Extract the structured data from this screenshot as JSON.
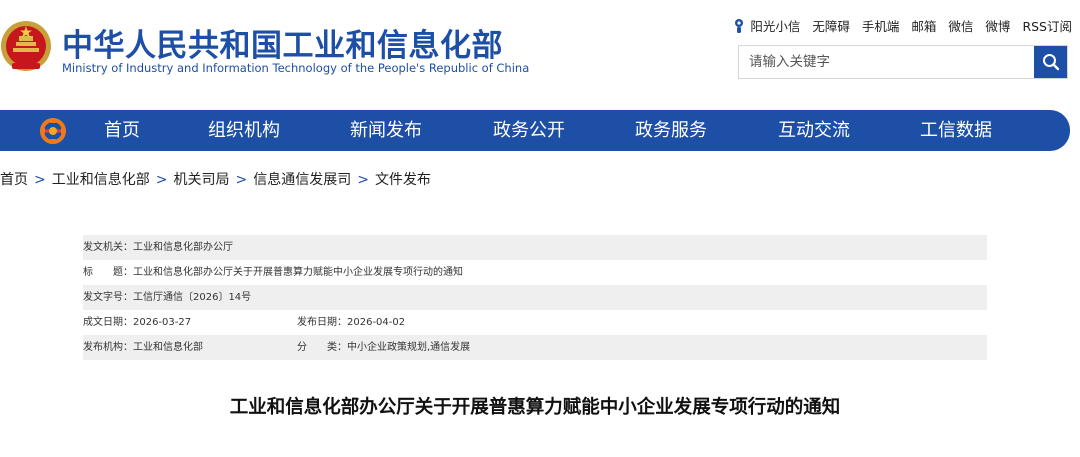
{
  "header": {
    "title_cn": "中华人民共和国工业和信息化部",
    "title_en": "Ministry of Industry and Information Technology of the People's Republic of China",
    "emblem_icon": "national-emblem-icon",
    "top_links": [
      "阳光小信",
      "无障碍",
      "手机端",
      "邮箱",
      "微信",
      "微博",
      "RSS订阅"
    ],
    "search_placeholder": "请输入关键字",
    "search_icon": "search-icon"
  },
  "colors": {
    "brand_blue": "#1e4fa6",
    "row_shade": "#efefef"
  },
  "nav": {
    "logo_icon": "ministry-logo-icon",
    "items": [
      "首页",
      "组织机构",
      "新闻发布",
      "政务公开",
      "政务服务",
      "互动交流",
      "工信数据"
    ]
  },
  "breadcrumb": [
    "首页",
    "工业和信息化部",
    "机关司局",
    "信息通信发展司",
    "文件发布"
  ],
  "meta": {
    "issuer_label": "发文机关：",
    "issuer": "工业和信息化部办公厅",
    "title_label": "标　　题：",
    "title": "工业和信息化部办公厅关于开展普惠算力赋能中小企业发展专项行动的通知",
    "doc_no_label": "发文字号：",
    "doc_no": "工信厅通信〔2026〕14号",
    "created_label": "成文日期：",
    "created": "2026-03-27",
    "published_label": "发布日期：",
    "published": "2026-04-02",
    "org_label": "发布机构：",
    "org": "工业和信息化部",
    "category_label": "分　　类：",
    "category": "中小企业政策规划,通信发展"
  },
  "article": {
    "title": "工业和信息化部办公厅关于开展普惠算力赋能中小企业发展专项行动的通知"
  }
}
